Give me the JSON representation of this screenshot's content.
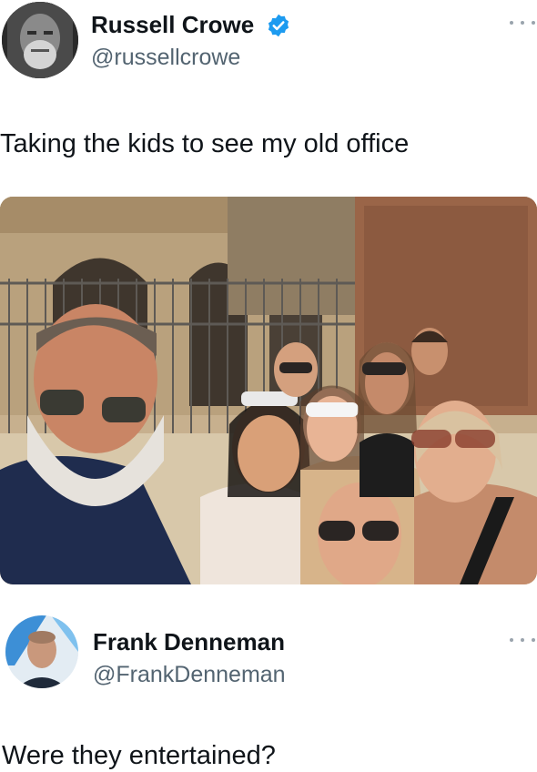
{
  "posts": [
    {
      "author_name": "Russell Crowe",
      "handle": "@russellcrowe",
      "verified": true,
      "text": "Taking the kids to see my old office",
      "avatar_icon": "person-avatar",
      "more_icon": "more-options-icon",
      "has_photo": true
    },
    {
      "author_name": "Frank Denneman",
      "handle": "@FrankDenneman",
      "verified": false,
      "text": "Were they entertained?",
      "avatar_icon": "person-avatar",
      "more_icon": "more-options-icon"
    }
  ],
  "colors": {
    "verified_blue": "#1d9bf0",
    "handle_gray": "#536471",
    "text": "#0f1419"
  }
}
